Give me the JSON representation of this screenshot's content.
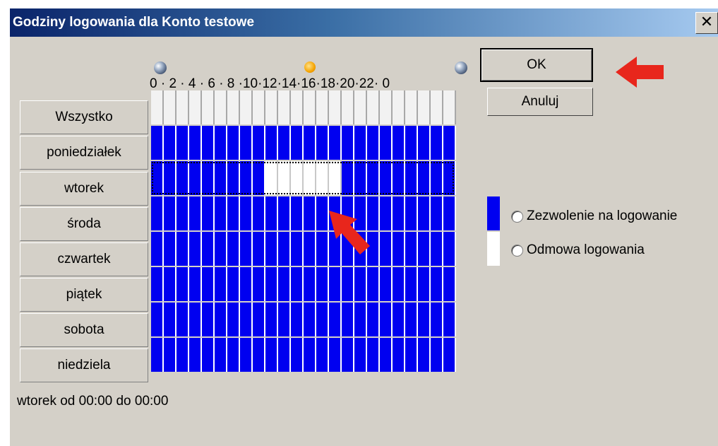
{
  "window": {
    "title": "Godziny logowania dla Konto testowe",
    "close_glyph": "✕"
  },
  "hours_ruler": "0 · 2 · 4 · 6 · 8 ·10·12·14·16·18·20·22· 0",
  "select_all_label": "Wszystko",
  "days": [
    {
      "label": "poniedziałek",
      "denied_hours": []
    },
    {
      "label": "wtorek",
      "denied_hours": [
        9,
        10,
        11,
        12,
        13,
        14
      ],
      "selected": true
    },
    {
      "label": "środa",
      "denied_hours": []
    },
    {
      "label": "czwartek",
      "denied_hours": []
    },
    {
      "label": "piątek",
      "denied_hours": []
    },
    {
      "label": "sobota",
      "denied_hours": []
    },
    {
      "label": "niedziela",
      "denied_hours": []
    }
  ],
  "buttons": {
    "ok": "OK",
    "cancel": "Anuluj"
  },
  "legend": {
    "allow_label": "Zezwolenie na logowanie",
    "deny_label": "Odmowa logowania",
    "allow_color": "#0000f0",
    "deny_color": "#ffffff"
  },
  "status_text": "wtorek od 00:00 do 00:00",
  "annotations": {
    "arrow_color": "#e8261c"
  },
  "icons": {
    "midnight_start": "moon-icon",
    "noon": "sun-icon",
    "midnight_end": "moon-icon"
  }
}
